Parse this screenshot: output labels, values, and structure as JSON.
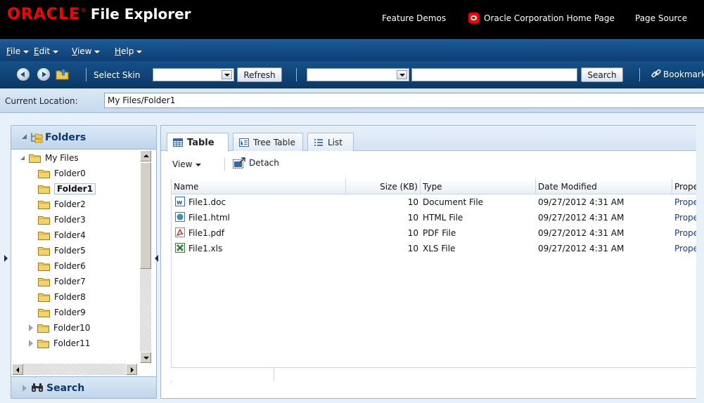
{
  "header": {
    "brand": "ORACLE",
    "brand_mark": "®",
    "title": "File Explorer",
    "links": [
      "Feature Demos",
      "Oracle Corporation Home Page",
      "Page Source"
    ]
  },
  "menubar": {
    "items": [
      {
        "label": "File",
        "mnemonic": "F"
      },
      {
        "label": "Edit",
        "mnemonic": "E"
      },
      {
        "label": "View",
        "mnemonic": "V"
      },
      {
        "label": "Help",
        "mnemonic": "H"
      }
    ]
  },
  "toolbar": {
    "select_skin_label": "Select Skin",
    "skin_value": "",
    "refresh_label": "Refresh",
    "search_scope_value": "",
    "search_value": "",
    "search_label": "Search",
    "bookmark_label": "Bookmark"
  },
  "location": {
    "label": "Current Location:",
    "value": "My Files/Folder1"
  },
  "left_panel": {
    "folders_title": "Folders",
    "search_title": "Search",
    "tree": [
      {
        "label": "My Files",
        "level": 0,
        "expander": "open"
      },
      {
        "label": "Folder0",
        "level": 1,
        "expander": "none"
      },
      {
        "label": "Folder1",
        "level": 1,
        "expander": "none",
        "selected": true
      },
      {
        "label": "Folder2",
        "level": 1,
        "expander": "none"
      },
      {
        "label": "Folder3",
        "level": 1,
        "expander": "none"
      },
      {
        "label": "Folder4",
        "level": 1,
        "expander": "none"
      },
      {
        "label": "Folder5",
        "level": 1,
        "expander": "none"
      },
      {
        "label": "Folder6",
        "level": 1,
        "expander": "none"
      },
      {
        "label": "Folder7",
        "level": 1,
        "expander": "none"
      },
      {
        "label": "Folder8",
        "level": 1,
        "expander": "none"
      },
      {
        "label": "Folder9",
        "level": 1,
        "expander": "none"
      },
      {
        "label": "Folder10",
        "level": 1,
        "expander": "closed"
      },
      {
        "label": "Folder11",
        "level": 1,
        "expander": "closed"
      }
    ]
  },
  "right_panel": {
    "tabs": [
      {
        "label": "Table",
        "icon": "table-icon",
        "active": true
      },
      {
        "label": "Tree Table",
        "icon": "tree-table-icon",
        "active": false
      },
      {
        "label": "List",
        "icon": "list-icon",
        "active": false
      }
    ],
    "view_menu_label": "View",
    "detach_label": "Detach",
    "columns": [
      "Name",
      "Size (KB)",
      "Type",
      "Date Modified",
      "Properties"
    ],
    "rows": [
      {
        "name": "File1.doc",
        "icon": "word-doc-icon",
        "size": "10",
        "type": "Document File",
        "modified": "09/27/2012 4:31 AM",
        "properties": "Properties"
      },
      {
        "name": "File1.html",
        "icon": "html-file-icon",
        "size": "10",
        "type": "HTML File",
        "modified": "09/27/2012 4:31 AM",
        "properties": "Properties"
      },
      {
        "name": "File1.pdf",
        "icon": "pdf-file-icon",
        "size": "10",
        "type": "PDF File",
        "modified": "09/27/2012 4:31 AM",
        "properties": "Properties"
      },
      {
        "name": "File1.xls",
        "icon": "excel-file-icon",
        "size": "10",
        "type": "XLS File",
        "modified": "09/27/2012 4:31 AM",
        "properties": "Properties"
      }
    ]
  },
  "colors": {
    "oracle_red": "#f80000",
    "header_bg": "#000000",
    "menubar_blue": "#0d3e73",
    "panel_blue": "#c5d9ee",
    "link_blue": "#0b3ea8"
  }
}
